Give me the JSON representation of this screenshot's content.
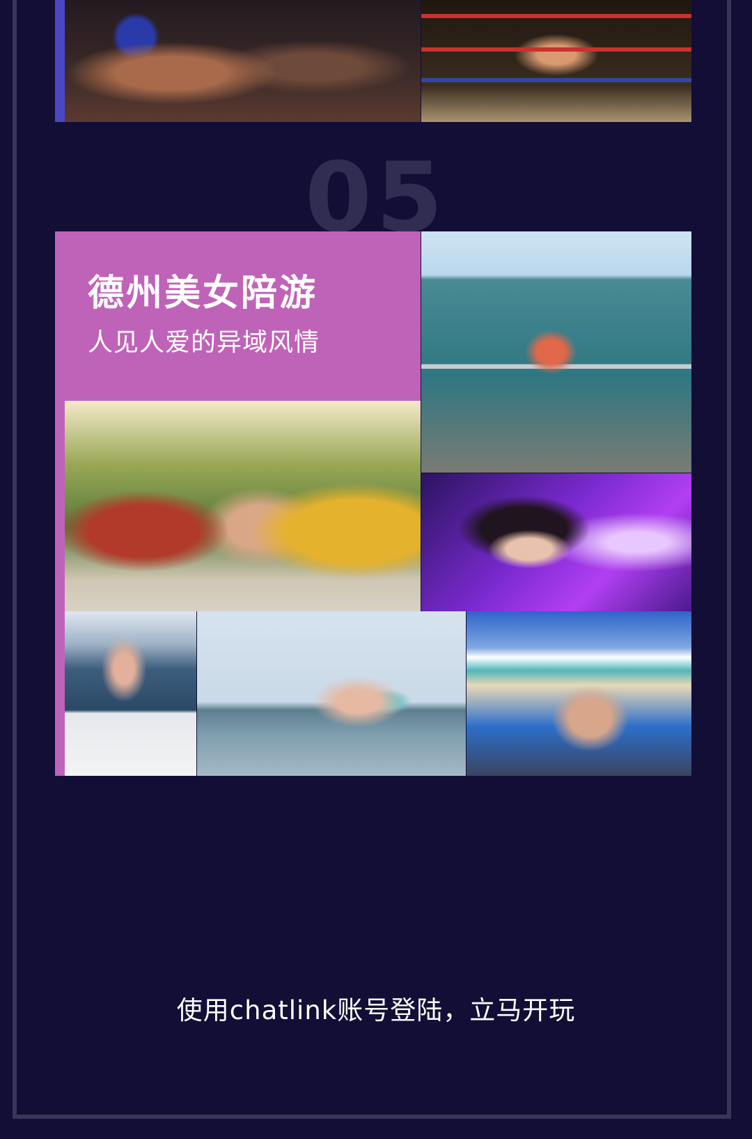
{
  "section": {
    "number": "05",
    "title": "德州美女陪游",
    "subtitle": "人见人爱的异域风情"
  },
  "footer": {
    "cta_text": "使用chatlink账号登陆，立马开玩"
  },
  "colors": {
    "background": "#120e36",
    "section_accent": "#bf63b8",
    "top_accent": "#4b47c4",
    "number_color": "#312d52"
  }
}
